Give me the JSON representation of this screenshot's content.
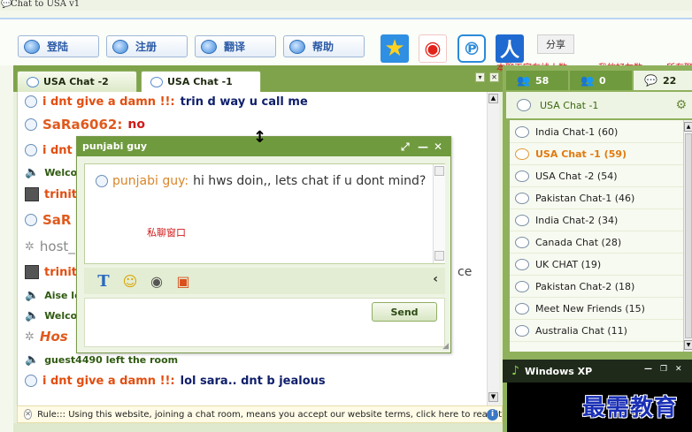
{
  "window": {
    "title": "Chat to USA v1"
  },
  "toolbar": {
    "buttons": [
      {
        "label": "登陆",
        "icon": "chat-bubble-icon"
      },
      {
        "label": "注册",
        "icon": "chat-bubble-icon"
      },
      {
        "label": "翻译",
        "icon": "chat-bubble-icon"
      },
      {
        "label": "帮助",
        "icon": "chat-bubble-icon"
      }
    ],
    "social_icons": [
      "star-icon",
      "weibo-icon",
      "pengyou-icon",
      "renren-icon"
    ],
    "share_label": "分享"
  },
  "chat": {
    "tabs": [
      {
        "label": "USA Chat -2",
        "active": false
      },
      {
        "label": "USA Chat -1",
        "active": true
      }
    ],
    "messages": [
      {
        "user": "i dnt give a damn !!:",
        "text": "trin d way u call me",
        "style": "red-navy"
      },
      {
        "user": "SaRa6062:",
        "text": "no",
        "style": "big-red"
      },
      {
        "user": "i dnt",
        "text": "",
        "style": "red-navy"
      },
      {
        "user": "Welco",
        "text": "",
        "style": "green"
      },
      {
        "user": "trinit",
        "text": "",
        "style": "red-avatar"
      },
      {
        "user": "SaR",
        "text": "",
        "style": "big-red"
      },
      {
        "user": "host_",
        "text": "",
        "style": "gray"
      },
      {
        "user": "trinit",
        "text": "",
        "style": "red-avatar"
      },
      {
        "user": "Aise le",
        "text": "",
        "style": "green"
      },
      {
        "user": "Welco",
        "text": "",
        "style": "green"
      },
      {
        "user": "Hos",
        "text": "",
        "style": "orange-italic"
      },
      {
        "user": "",
        "text": "guest4490 left the room",
        "style": "green"
      },
      {
        "user": "i dnt give a damn !!:",
        "text": "lol sara.. dnt b jealous",
        "style": "red-navy"
      }
    ],
    "partial_text": "ce",
    "rule_text": "Rule::: Using this website, joining a chat room, means you accept our website terms, click here to read it"
  },
  "private_chat": {
    "title": "punjabi guy",
    "message_user": "punjabi guy:",
    "message_text": "hi hws doin,, lets chat if u dont mind?",
    "annotation": "私聊窗口",
    "send_label": "Send",
    "tools": [
      "font-icon",
      "smiley-icon",
      "webcam-icon",
      "gift-icon"
    ]
  },
  "sidebar": {
    "annotations": [
      "本聊天室在线人数",
      "我的好友数",
      "所有聊"
    ],
    "counts": [
      {
        "value": "58",
        "icon": "users-icon"
      },
      {
        "value": "0",
        "icon": "friends-icon"
      },
      {
        "value": "22",
        "icon": "chat-bubble-icon"
      }
    ],
    "current_room": "USA Chat -1",
    "rooms": [
      {
        "label": "India Chat-1 (60)",
        "active": false
      },
      {
        "label": "USA Chat -1 (59)",
        "active": true
      },
      {
        "label": "USA Chat -2 (54)",
        "active": false
      },
      {
        "label": "Pakistan Chat-1 (46)",
        "active": false
      },
      {
        "label": "India Chat-2 (34)",
        "active": false
      },
      {
        "label": "Canada Chat (28)",
        "active": false
      },
      {
        "label": "UK CHAT (19)",
        "active": false
      },
      {
        "label": "Pakistan Chat-2 (18)",
        "active": false
      },
      {
        "label": "Meet New Friends (15)",
        "active": false
      },
      {
        "label": "Australia Chat (11)",
        "active": false
      }
    ],
    "media_title": "Windows XP",
    "watermark": "最需教育"
  },
  "colors": {
    "accent_green": "#7fa34a",
    "title_green": "#6f9a3e",
    "username_red": "#e24e10",
    "text_navy": "#10206b",
    "annotation_red": "#d11a1a",
    "active_room_orange": "#e07a10"
  }
}
